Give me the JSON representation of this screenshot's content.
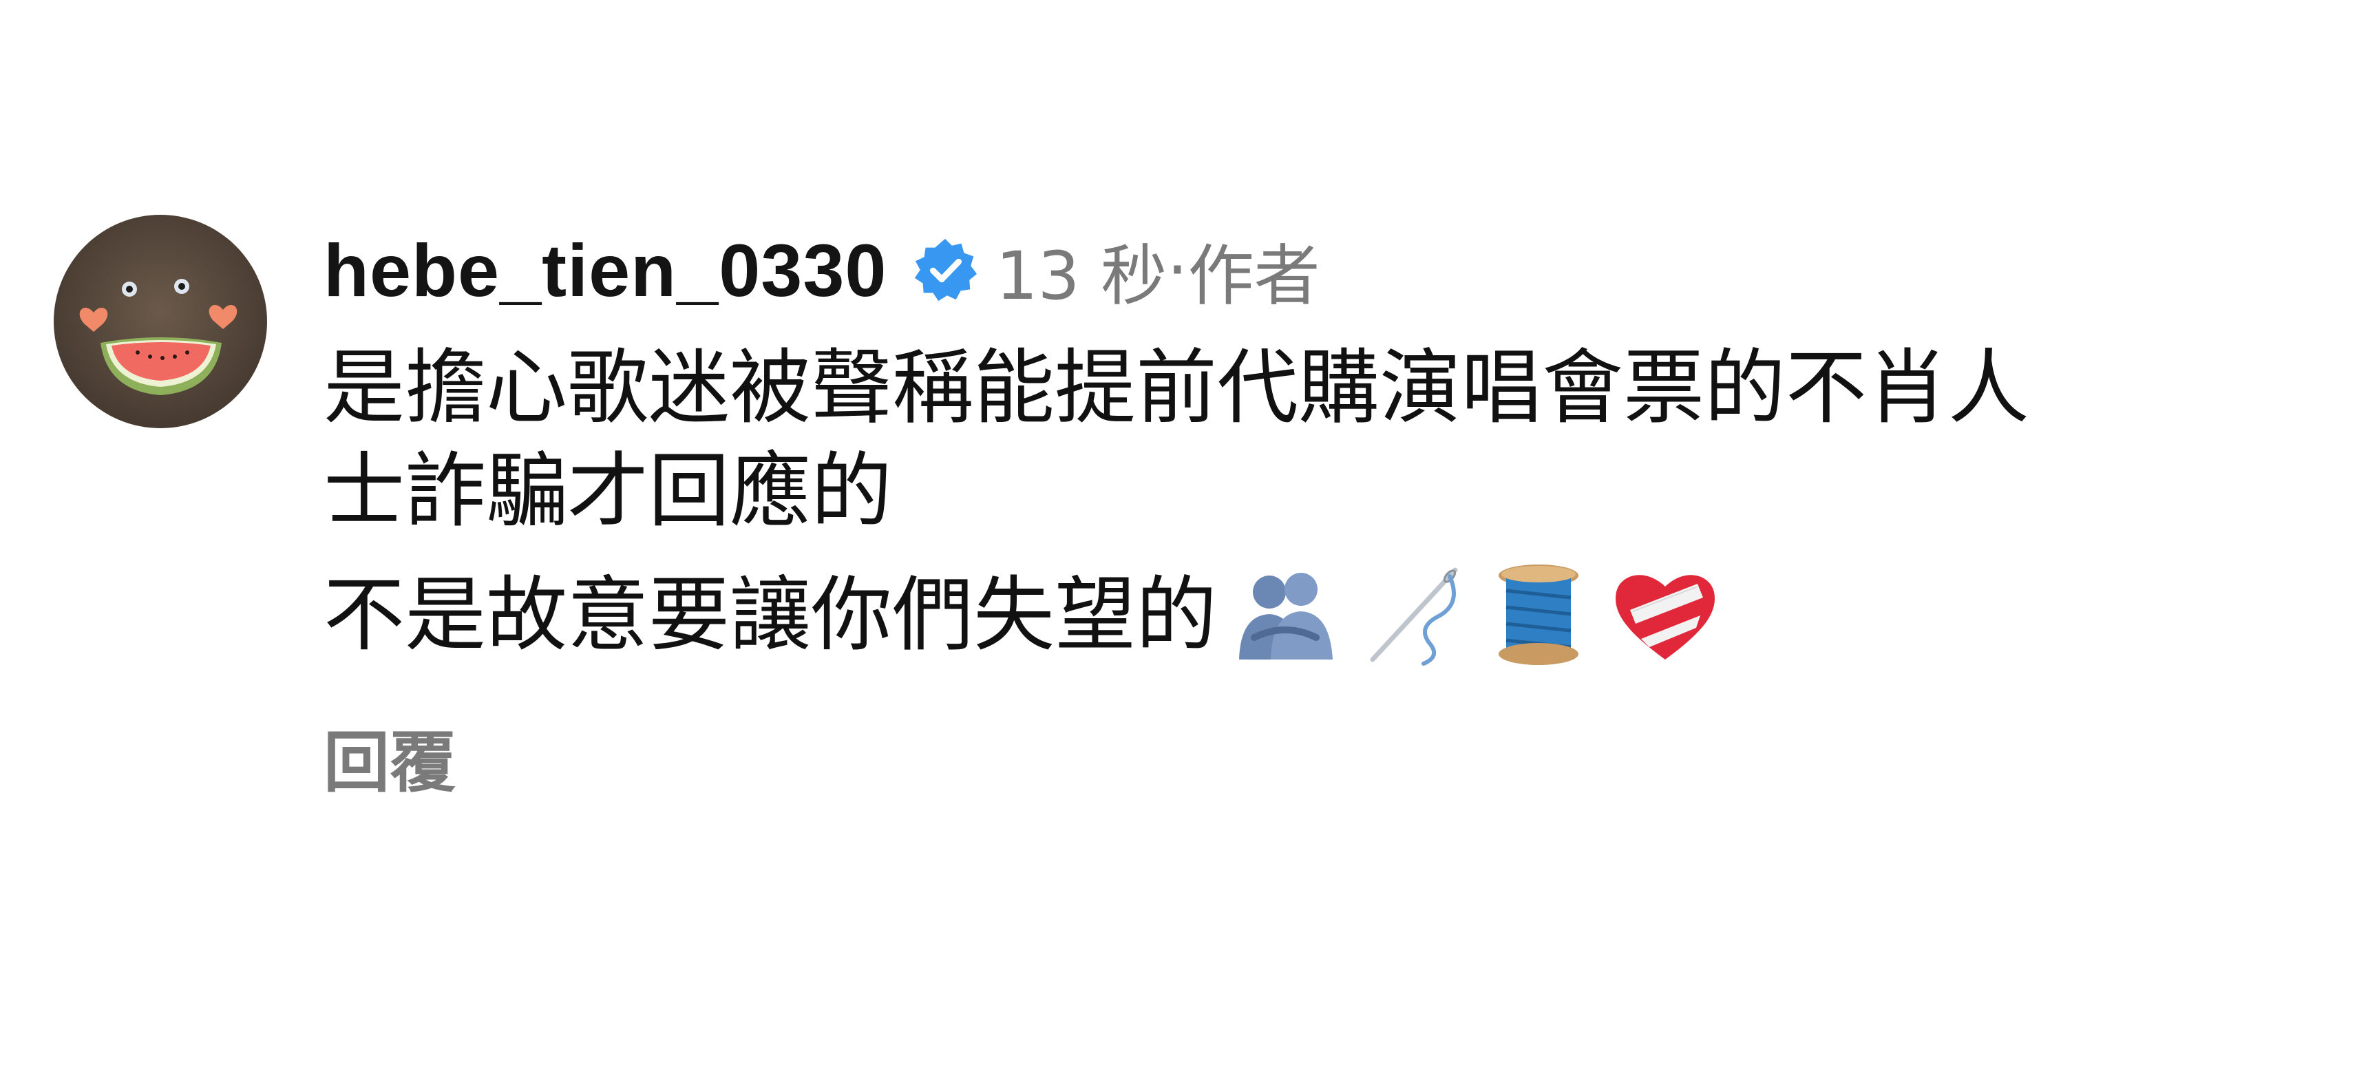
{
  "comment": {
    "username": "hebe_tien_0330",
    "verified_icon": "verified-badge-icon",
    "time": "13 秒",
    "separator": "·",
    "role": "作者",
    "lines": [
      "是擔心歌迷被聲稱能提前代購演唱會票的不肖人",
      "士詐騙才回應的",
      "不是故意要讓你們失望的"
    ],
    "emojis": [
      "people-hugging-icon",
      "needle-thread-icon",
      "thread-spool-icon",
      "mending-heart-icon"
    ],
    "reply_label": "回覆",
    "colors": {
      "verified": "#3897f0",
      "meta": "#7a7a7a",
      "text": "#111111"
    }
  }
}
